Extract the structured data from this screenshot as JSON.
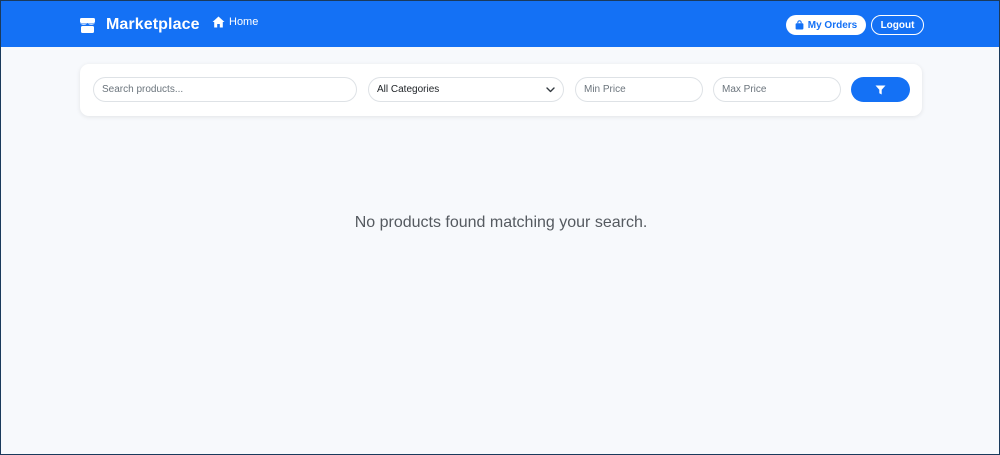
{
  "navbar": {
    "brand": "Marketplace",
    "home_label": "Home",
    "orders_label": "My Orders",
    "logout_label": "Logout",
    "icons": {
      "brand": "store-icon",
      "home": "home-icon",
      "orders": "shopping-bag-icon"
    }
  },
  "filters": {
    "search_placeholder": "Search products...",
    "category_value": "All Categories",
    "min_price_placeholder": "Min Price",
    "max_price_placeholder": "Max Price",
    "filter_icon": "funnel-icon"
  },
  "results": {
    "empty_message": "No products found matching your search."
  },
  "colors": {
    "primary": "#1471f5",
    "background": "#f7f9fc",
    "text_muted": "#555a60"
  }
}
